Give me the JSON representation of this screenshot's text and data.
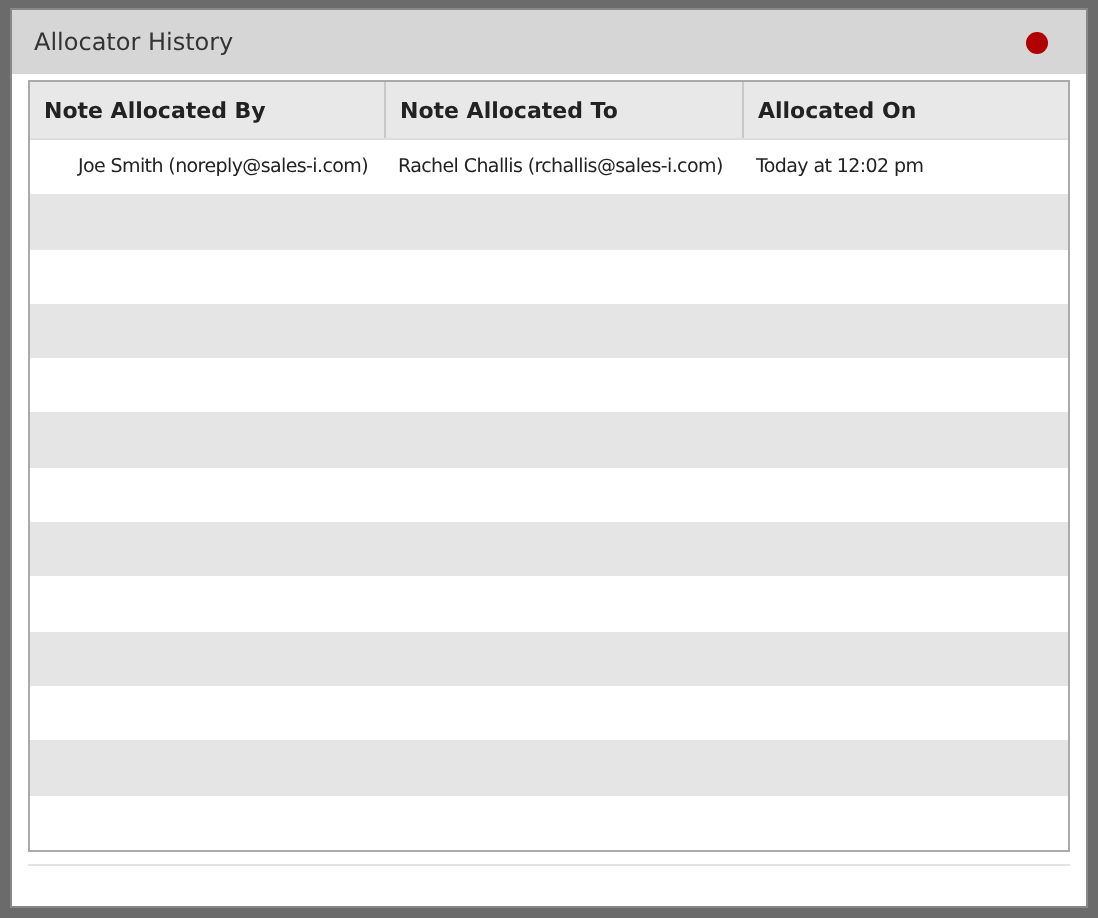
{
  "window": {
    "title": "Allocator History"
  },
  "table": {
    "columns": [
      "Note Allocated By",
      "Note Allocated To",
      "Allocated On"
    ],
    "rows": [
      [
        "Joe Smith (noreply@sales-i.com)",
        "Rachel Challis (rchallis@sales-i.com)",
        "Today at 12:02 pm"
      ]
    ]
  }
}
